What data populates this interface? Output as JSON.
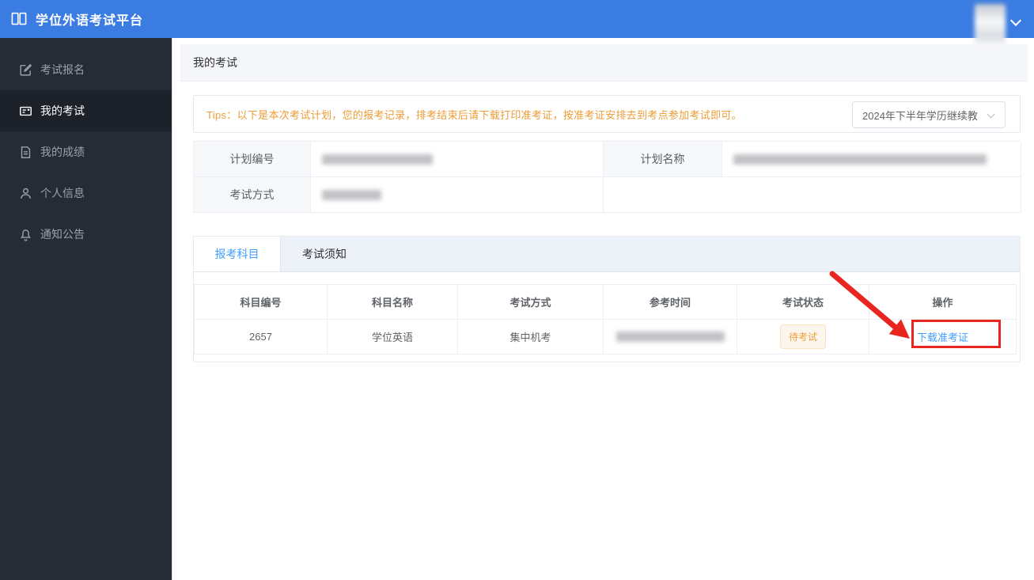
{
  "app": {
    "colors": {
      "header_blue": "#3b7ce2",
      "accent_blue": "#409eff",
      "warning_orange": "#e6a23c",
      "annotation_red": "#e8261f",
      "sidebar_dark": "#262c35"
    }
  },
  "header": {
    "title": "学位外语考试平台"
  },
  "sidebar": {
    "items": [
      {
        "label": "考试报名",
        "icon": "edit-square-icon",
        "active": false
      },
      {
        "label": "我的考试",
        "icon": "exam-card-icon",
        "active": true
      },
      {
        "label": "我的成绩",
        "icon": "score-document-icon",
        "active": false
      },
      {
        "label": "个人信息",
        "icon": "person-icon",
        "active": false
      },
      {
        "label": "通知公告",
        "icon": "bell-icon",
        "active": false
      }
    ]
  },
  "breadcrumb": {
    "title": "我的考试"
  },
  "tips": {
    "text": "Tips：以下是本次考试计划，您的报考记录，排考结束后请下载打印准考证，按准考证安排去到考点参加考试即可。"
  },
  "plan_filter": {
    "value": "2024年下半年学历继续教"
  },
  "plan_info": {
    "plan_no_label": "计划编号",
    "plan_name_label": "计划名称",
    "exam_mode_label": "考试方式",
    "values_redacted": true
  },
  "tabs": {
    "items": [
      {
        "label": "报考科目",
        "active": true
      },
      {
        "label": "考试须知",
        "active": false
      }
    ]
  },
  "subjects_table": {
    "columns": [
      "科目编号",
      "科目名称",
      "考试方式",
      "参考时间",
      "考试状态",
      "操作"
    ],
    "rows": [
      {
        "code": "2657",
        "name": "学位英语",
        "mode": "集中机考",
        "time_redacted": true,
        "status": "待考试",
        "action": "下载准考证"
      }
    ]
  }
}
